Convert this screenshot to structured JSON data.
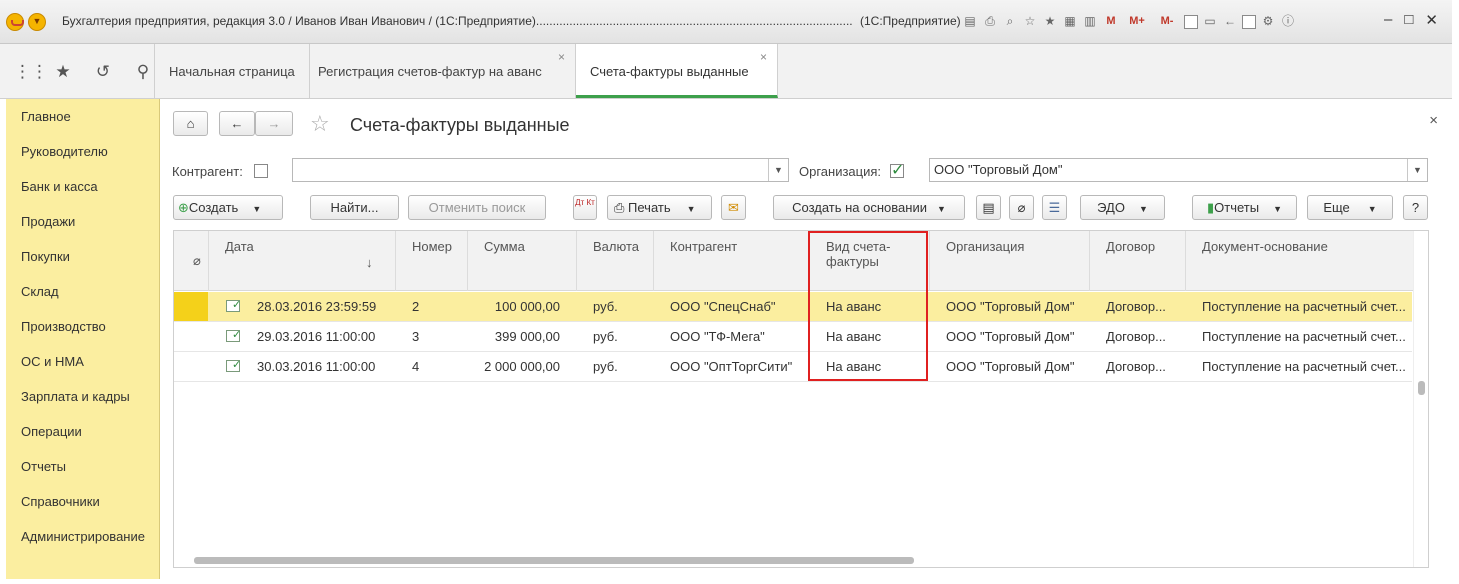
{
  "window": {
    "title": "Бухгалтерия предприятия, редакция 3.0 / Иванов Иван Иванович / (1С:Предприятие)...............................................................................................",
    "title_suffix": "(1С:Предприятие)",
    "memory_buttons": [
      "M",
      "M+",
      "M-"
    ]
  },
  "tabs": [
    {
      "label": "Начальная страница"
    },
    {
      "label": "Регистрация счетов-фактур на аванс"
    },
    {
      "label": "Счета-фактуры выданные"
    }
  ],
  "sidebar": {
    "items": [
      "Главное",
      "Руководителю",
      "Банк и касса",
      "Продажи",
      "Покупки",
      "Склад",
      "Производство",
      "ОС и НМА",
      "Зарплата и кадры",
      "Операции",
      "Отчеты",
      "Справочники",
      "Администрирование"
    ]
  },
  "page": {
    "title": "Счета-фактуры выданные",
    "counterparty_label": "Контрагент:",
    "counterparty_value": "",
    "organization_label": "Организация:",
    "organization_value": "ООО \"Торговый Дом\""
  },
  "toolbar": {
    "create": "Создать",
    "find": "Найти...",
    "cancel_search": "Отменить поиск",
    "dtkt": "Дт Кт",
    "print": "Печать",
    "create_based_on": "Создать на основании",
    "edo": "ЭДО",
    "reports": "Отчеты",
    "more": "Еще",
    "help": "?"
  },
  "table": {
    "columns": [
      "Дата",
      "Номер",
      "Сумма",
      "Валюта",
      "Контрагент",
      "Вид счета-фактуры",
      "Организация",
      "Договор",
      "Документ-основание"
    ],
    "rows": [
      {
        "date": "28.03.2016 23:59:59",
        "number": "2",
        "sum": "100 000,00",
        "currency": "руб.",
        "counterparty": "ООО \"СпецСнаб\"",
        "type": "На аванс",
        "organization": "ООО \"Торговый Дом\"",
        "contract": "Договор...",
        "basis": "Поступление на расчетный счет..."
      },
      {
        "date": "29.03.2016 11:00:00",
        "number": "3",
        "sum": "399 000,00",
        "currency": "руб.",
        "counterparty": "ООО \"ТФ-Мега\"",
        "type": "На аванс",
        "organization": "ООО \"Торговый Дом\"",
        "contract": "Договор...",
        "basis": "Поступление на расчетный счет..."
      },
      {
        "date": "30.03.2016 11:00:00",
        "number": "4",
        "sum": "2 000 000,00",
        "currency": "руб.",
        "counterparty": "ООО \"ОптТоргСити\"",
        "type": "На аванс",
        "organization": "ООО \"Торговый Дом\"",
        "contract": "Договор...",
        "basis": "Поступление на расчетный счет..."
      }
    ]
  },
  "colors": {
    "accent": "#3da04b",
    "sidebar_bg": "#fbeea0",
    "selection": "#fbee9f",
    "highlight_box": "#e02020"
  }
}
